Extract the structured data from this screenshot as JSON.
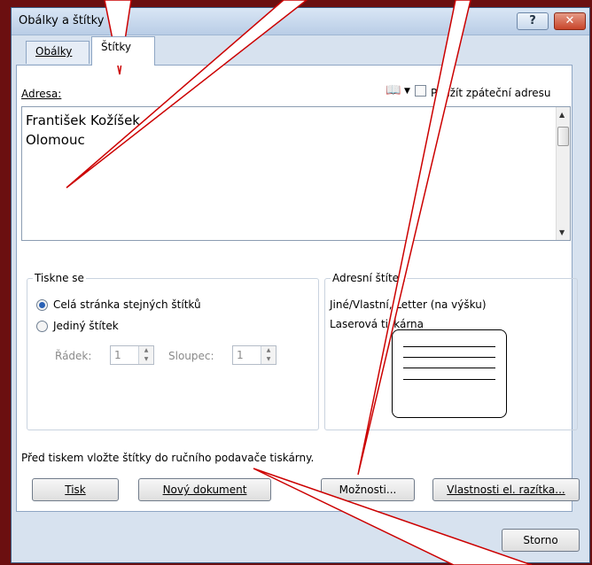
{
  "window": {
    "title": "Obálky a štítky",
    "help_label": "?",
    "close_label": "✕"
  },
  "tabs": [
    {
      "label": "Obálky"
    },
    {
      "label": "Štítky"
    }
  ],
  "address": {
    "label": "Adresa:",
    "lines": "František Kožíšek\nOlomouc",
    "use_return_label": "Použít zpáteční adresu"
  },
  "print_group": {
    "title": "Tiskne se",
    "option_full": "Celá stránka stejných štítků",
    "option_single": "Jediný štítek",
    "row_label": "Řádek:",
    "row_value": "1",
    "column_label": "Sloupec:",
    "column_value": "1"
  },
  "label_group": {
    "title": "Adresní štítek",
    "line1": "Jiné/Vlastní, Letter (na výšku)",
    "line2": "Laserová tiskárna"
  },
  "hint": "Před tiskem vložte štítky do ručního podavače tiskárny.",
  "buttons": {
    "print": "Tisk",
    "new_doc": "Nový dokument",
    "options": "Možnosti...",
    "postage": "Vlastnosti el. razítka...",
    "cancel": "Storno"
  },
  "icons": {
    "address_book": "address-book-icon",
    "dropdown": "chevron-down-icon"
  },
  "colors": {
    "background": "#6b0f10",
    "callout": "#cc0000",
    "radio_selected": "#2a61b5"
  }
}
